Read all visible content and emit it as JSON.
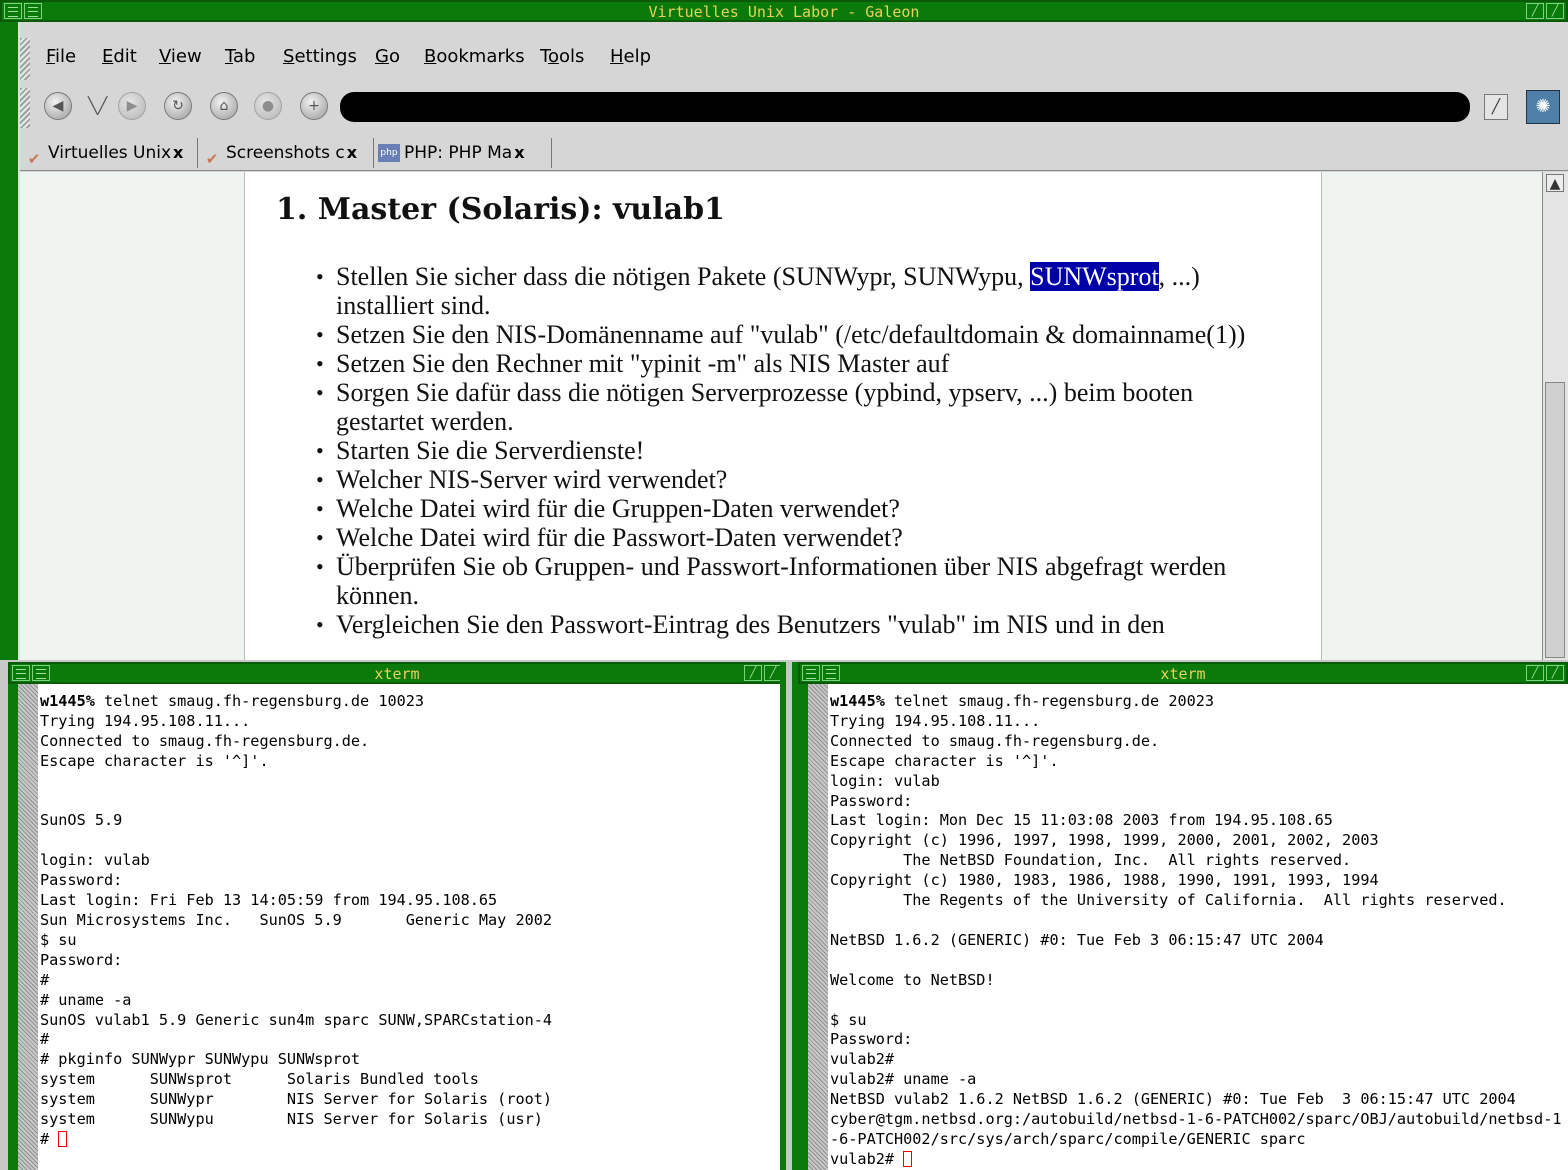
{
  "galeon": {
    "title": "Virtuelles Unix Labor - Galeon",
    "menu": [
      {
        "label": "File",
        "mnemonic": "F"
      },
      {
        "label": "Edit",
        "mnemonic": "E"
      },
      {
        "label": "View",
        "mnemonic": "V"
      },
      {
        "label": "Tab",
        "mnemonic": "T"
      },
      {
        "label": "Settings",
        "mnemonic": "S"
      },
      {
        "label": "Go",
        "mnemonic": "G"
      },
      {
        "label": "Bookmarks",
        "mnemonic": "B"
      },
      {
        "label": "Tools",
        "mnemonic": "o"
      },
      {
        "label": "Help",
        "mnemonic": "H"
      }
    ],
    "tabs": [
      {
        "label": "Virtuelles Unix",
        "icon": "galeon-icon",
        "close": "x"
      },
      {
        "label": "Screenshots c",
        "icon": "galeon-icon",
        "close": "x"
      },
      {
        "label": "PHP: PHP Ma",
        "icon": "php-icon",
        "icon_text": "php",
        "close": "x"
      }
    ],
    "page": {
      "heading": "1. Master (Solaris): vulab1",
      "bullets": [
        {
          "pre": "Stellen Sie sicher dass die nötigen Pakete (SUNWypr, SUNWypu, ",
          "highlight": "SUNWsprot",
          "post": ", ...) installiert sind."
        },
        {
          "pre": "Setzen Sie den NIS-Domänenname auf \"vulab\" (/etc/defaultdomain & domainname(1))",
          "highlight": "",
          "post": ""
        },
        {
          "pre": "Setzen Sie den Rechner mit \"ypinit -m\" als NIS Master auf",
          "highlight": "",
          "post": ""
        },
        {
          "pre": "Sorgen Sie dafür dass die nötigen Serverprozesse (ypbind, ypserv, ...) beim booten gestartet werden.",
          "highlight": "",
          "post": ""
        },
        {
          "pre": "Starten Sie die Serverdienste!",
          "highlight": "",
          "post": ""
        },
        {
          "pre": "Welcher NIS-Server wird verwendet?",
          "highlight": "",
          "post": ""
        },
        {
          "pre": "Welche Datei wird für die Gruppen-Daten verwendet?",
          "highlight": "",
          "post": ""
        },
        {
          "pre": "Welche Datei wird für die Passwort-Daten verwendet?",
          "highlight": "",
          "post": ""
        },
        {
          "pre": "Überprüfen Sie ob Gruppen- und Passwort-Informationen über NIS abgefragt werden können.",
          "highlight": "",
          "post": ""
        },
        {
          "pre": "Vergleichen Sie den Passwort-Eintrag des Benutzers \"vulab\" im NIS und in den",
          "highlight": "",
          "post": ""
        }
      ]
    }
  },
  "xterm_left": {
    "title": "xterm",
    "prompt": "w1445%",
    "lines": [
      " telnet smaug.fh-regensburg.de 10023",
      "Trying 194.95.108.11...",
      "Connected to smaug.fh-regensburg.de.",
      "Escape character is '^]'.",
      "",
      "",
      "SunOS 5.9",
      "",
      "login: vulab",
      "Password:",
      "Last login: Fri Feb 13 14:05:59 from 194.95.108.65",
      "Sun Microsystems Inc.   SunOS 5.9       Generic May 2002",
      "$ su",
      "Password:",
      "#",
      "# uname -a",
      "SunOS vulab1 5.9 Generic sun4m sparc SUNW,SPARCstation-4",
      "#",
      "# pkginfo SUNWypr SUNWypu SUNWsprot",
      "system      SUNWsprot      Solaris Bundled tools",
      "system      SUNWypr        NIS Server for Solaris (root)",
      "system      SUNWypu        NIS Server for Solaris (usr)",
      "# "
    ]
  },
  "xterm_right": {
    "title": "xterm",
    "prompt": "w1445%",
    "lines": [
      " telnet smaug.fh-regensburg.de 20023",
      "Trying 194.95.108.11...",
      "Connected to smaug.fh-regensburg.de.",
      "Escape character is '^]'.",
      "login: vulab",
      "Password:",
      "Last login: Mon Dec 15 11:03:08 2003 from 194.95.108.65",
      "Copyright (c) 1996, 1997, 1998, 1999, 2000, 2001, 2002, 2003",
      "        The NetBSD Foundation, Inc.  All rights reserved.",
      "Copyright (c) 1980, 1983, 1986, 1988, 1990, 1991, 1993, 1994",
      "        The Regents of the University of California.  All rights reserved.",
      "",
      "NetBSD 1.6.2 (GENERIC) #0: Tue Feb 3 06:15:47 UTC 2004",
      "",
      "Welcome to NetBSD!",
      "",
      "$ su",
      "Password:",
      "vulab2#",
      "vulab2# uname -a",
      "NetBSD vulab2 1.6.2 NetBSD 1.6.2 (GENERIC) #0: Tue Feb  3 06:15:47 UTC 2004",
      "cyber@tgm.netbsd.org:/autobuild/netbsd-1-6-PATCH002/sparc/OBJ/autobuild/netbsd-1",
      "-6-PATCH002/src/sys/arch/sparc/compile/GENERIC sparc",
      "vulab2# "
    ]
  },
  "colors": {
    "titlebar": "#0a7a0a",
    "title_text": "#e8d25a",
    "selection": "#0000a8",
    "cursor": "#e00000"
  }
}
